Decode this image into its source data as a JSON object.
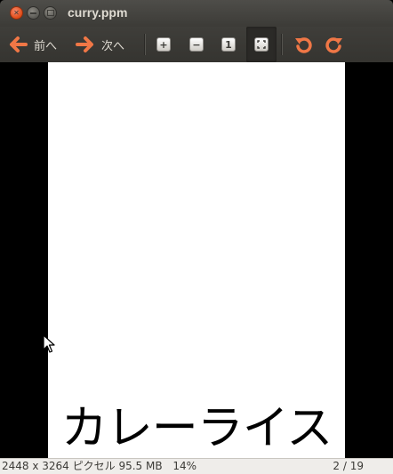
{
  "window": {
    "title": "curry.ppm"
  },
  "toolbar": {
    "prev_label": "前へ",
    "next_label": "次へ",
    "arrow_color": "#f07746",
    "buttons": [
      {
        "name": "zoom-in",
        "icon": "zoom-in-icon",
        "glyph": "+"
      },
      {
        "name": "zoom-out",
        "icon": "zoom-out-icon",
        "glyph": "−"
      },
      {
        "name": "zoom-normal",
        "icon": "zoom-normal-icon",
        "glyph": "1"
      },
      {
        "name": "zoom-fit",
        "icon": "zoom-fit-icon",
        "glyph": "⤧",
        "active": true
      },
      {
        "name": "rotate-left",
        "icon": "rotate-left-icon"
      },
      {
        "name": "rotate-right",
        "icon": "rotate-right-icon"
      }
    ]
  },
  "image": {
    "text": "カレーライス"
  },
  "status": {
    "dimensions": "2448 x 3264 ピクセル",
    "size": "95.5 MB",
    "zoom": "14%",
    "page": "2 / 19"
  },
  "colors": {
    "titlebar": "#3c3b37",
    "toolbar": "#3c3b37",
    "statusbar": "#efedea",
    "close_button": "#df4a16"
  }
}
